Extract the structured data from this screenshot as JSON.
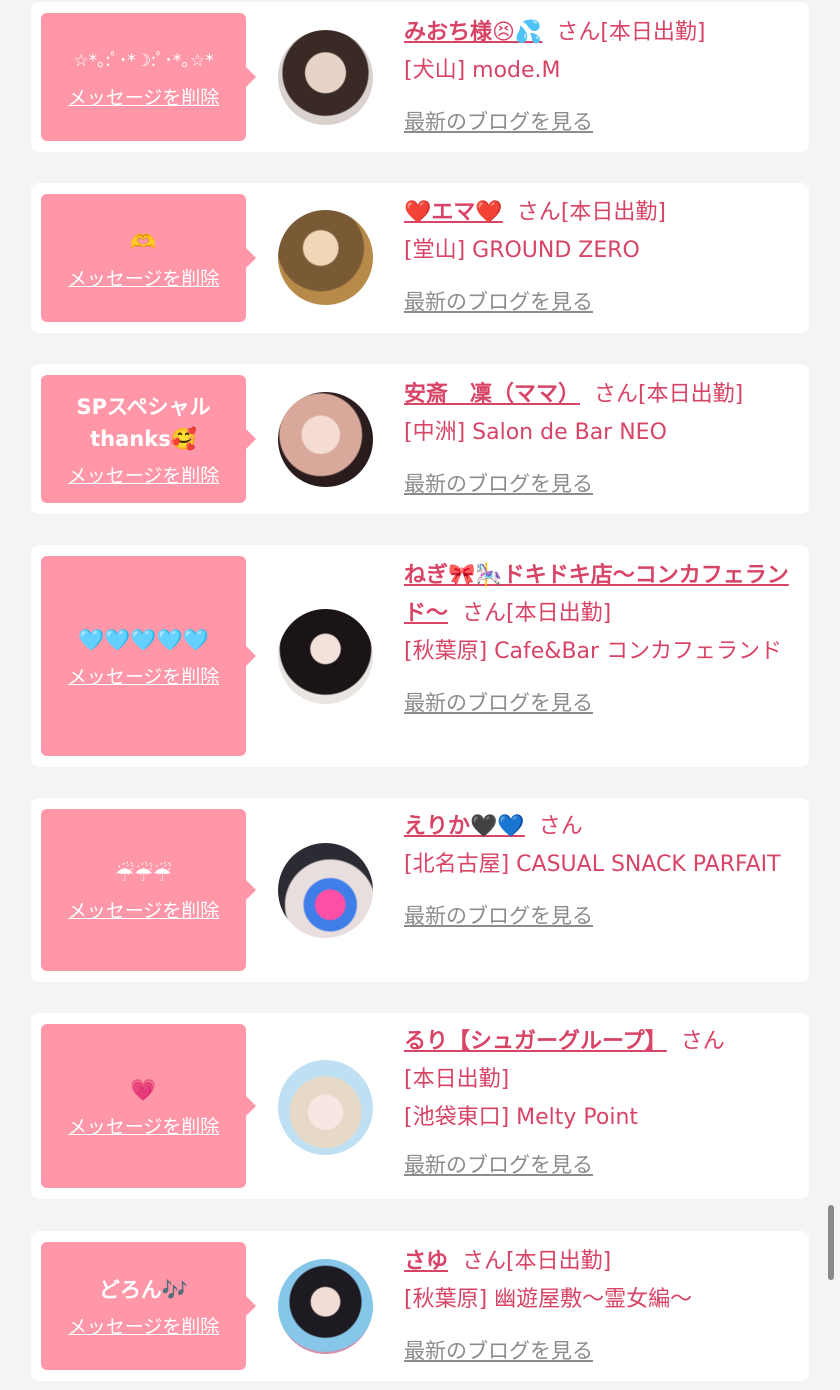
{
  "messages": [
    {
      "bubble_text": "☆*｡:ﾟ･*☽:ﾟ･*｡☆*",
      "delete_label": "メッセージを削除",
      "name": "みおち様😣💦",
      "san": "さん",
      "status": "[本日出勤]",
      "shop": "[犬山] mode.M",
      "blog_label": "最新のブログを見る"
    },
    {
      "bubble_text": "🫶",
      "delete_label": "メッセージを削除",
      "name": "❤️エマ❤️",
      "san": "さん",
      "status": "[本日出勤]",
      "shop": "[堂山] GROUND ZERO",
      "blog_label": "最新のブログを見る"
    },
    {
      "bubble_text": "SPスペシャル\nthanks🥰",
      "delete_label": "メッセージを削除",
      "name": "安斎　凜（ママ）",
      "san": "さん",
      "status": "[本日出勤]",
      "shop": "[中洲] Salon de Bar NEO",
      "blog_label": "最新のブログを見る"
    },
    {
      "bubble_text": "🩵🩵🩵🩵🩵",
      "delete_label": "メッセージを削除",
      "name": "ねぎ🎀🎠ドキドキ店〜コンカフェランド〜",
      "san": "さん",
      "status": "[本日出勤]",
      "shop": "[秋葉原] Cafe&Bar コンカフェランド",
      "blog_label": "最新のブログを見る"
    },
    {
      "bubble_text": "☔☔☔",
      "delete_label": "メッセージを削除",
      "name": "えりか🖤💙",
      "san": "さん",
      "status": "",
      "shop": "[北名古屋] CASUAL SNACK PARFAIT",
      "blog_label": "最新のブログを見る"
    },
    {
      "bubble_text": "💗",
      "delete_label": "メッセージを削除",
      "name": "るり【シュガーグループ】",
      "san": "さん",
      "status": "[本日出勤]",
      "shop": "[池袋東口] Melty Point",
      "blog_label": "最新のブログを見る"
    },
    {
      "bubble_text": "どろん🎶",
      "delete_label": "メッセージを削除",
      "name": "さゆ",
      "san": "さん",
      "status": "[本日出勤]",
      "shop": "[秋葉原] 幽遊屋敷〜霊女編〜",
      "blog_label": "最新のブログを見る"
    }
  ],
  "colors": {
    "accent": "#d84466",
    "bubble": "#ff97a8",
    "link_gray": "#8c8c8c",
    "background": "#f4f4f4"
  }
}
